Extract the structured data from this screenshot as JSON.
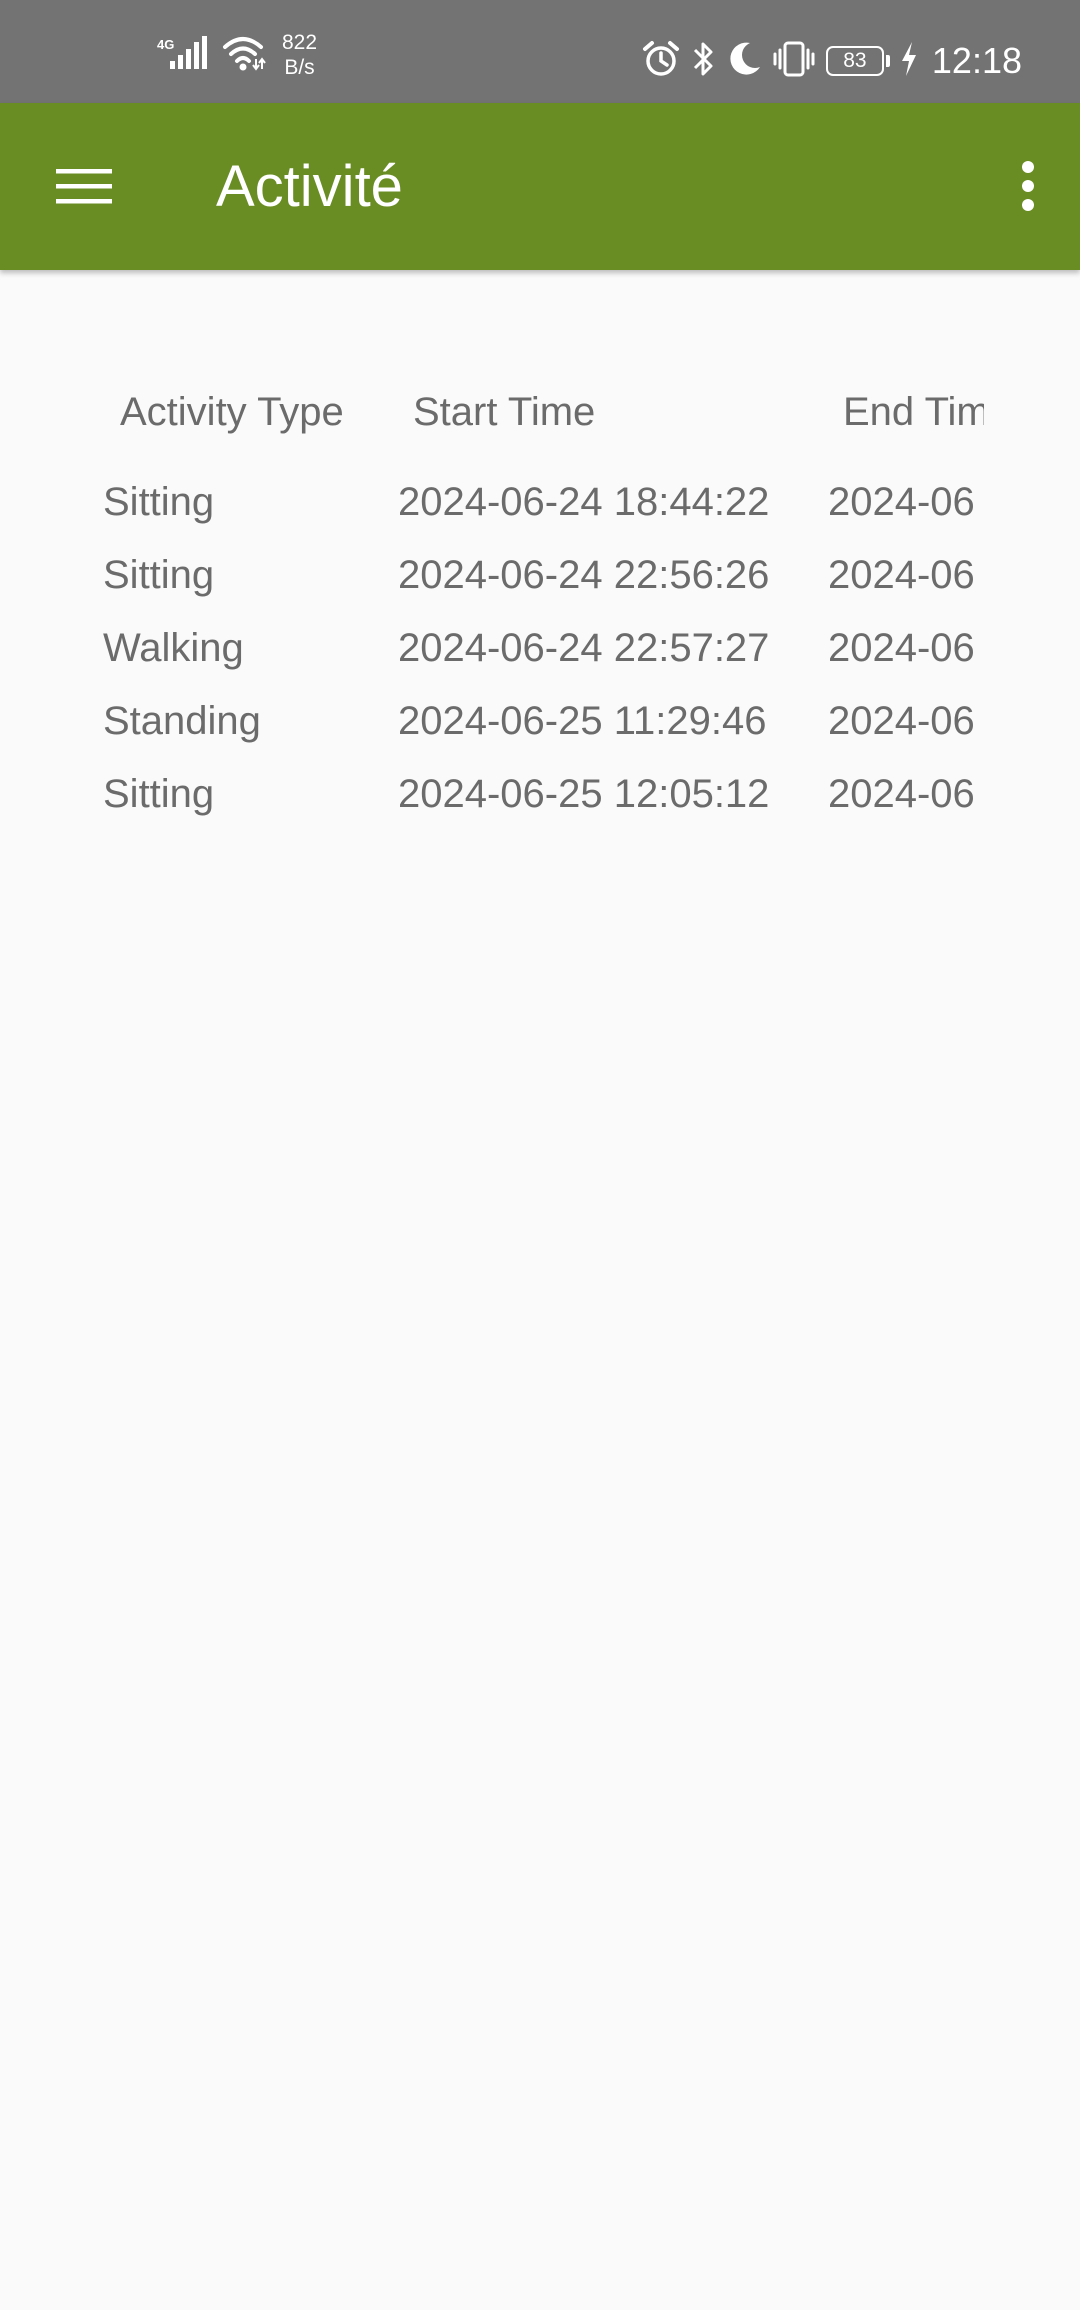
{
  "status_bar": {
    "network": "4G",
    "speed_value": "822",
    "speed_unit": "B/s",
    "battery": "83",
    "time": "12:18"
  },
  "app_bar": {
    "title": "Activité",
    "background_color": "#6a8d23",
    "menu_icon": "hamburger-menu-icon",
    "more_icon": "more-vertical-icon"
  },
  "table": {
    "headers": {
      "activity_type": "Activity Type",
      "start_time": "Start Time",
      "end_time": "End Tim"
    },
    "rows": [
      {
        "activity_type": "Sitting",
        "start_time": "2024-06-24 18:44:22",
        "end_time": "2024-06"
      },
      {
        "activity_type": "Sitting",
        "start_time": "2024-06-24 22:56:26",
        "end_time": "2024-06"
      },
      {
        "activity_type": "Walking",
        "start_time": "2024-06-24 22:57:27",
        "end_time": "2024-06"
      },
      {
        "activity_type": "Standing",
        "start_time": "2024-06-25 11:29:46",
        "end_time": "2024-06"
      },
      {
        "activity_type": "Sitting",
        "start_time": "2024-06-25 12:05:12",
        "end_time": "2024-06"
      }
    ]
  }
}
